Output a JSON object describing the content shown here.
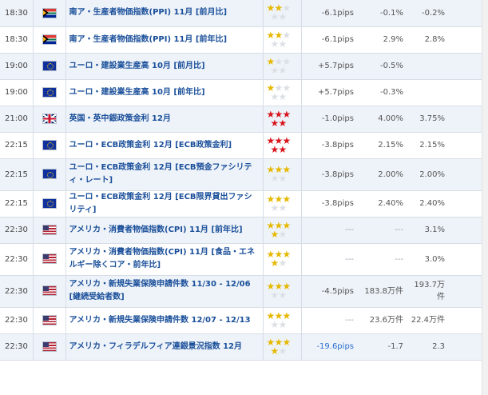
{
  "star_colors": {
    "gold": "#e6b800",
    "red": "#d9141b",
    "empty": "#dcdfe4"
  },
  "rows": [
    {
      "time": "18:30",
      "flag": "south-africa-flag",
      "event": "南ア・生産者物価指数(PPI) 11月 [前月比]",
      "stars": [
        2,
        0
      ],
      "pips": "-6.1pips",
      "prev": "-0.1%",
      "forecast": "-0.2%",
      "result": ""
    },
    {
      "time": "18:30",
      "flag": "south-africa-flag",
      "event": "南ア・生産者物価指数(PPI) 11月 [前年比]",
      "stars": [
        2,
        0
      ],
      "pips": "-6.1pips",
      "prev": "2.9%",
      "forecast": "2.8%",
      "result": ""
    },
    {
      "time": "19:00",
      "flag": "eu-flag",
      "event": "ユーロ・建設業生産高 10月 [前月比]",
      "stars": [
        1,
        0
      ],
      "pips": "+5.7pips",
      "prev": "-0.5%",
      "forecast": "",
      "result": ""
    },
    {
      "time": "19:00",
      "flag": "eu-flag",
      "event": "ユーロ・建設業生産高 10月 [前年比]",
      "stars": [
        1,
        0
      ],
      "pips": "+5.7pips",
      "prev": "-0.3%",
      "forecast": "",
      "result": ""
    },
    {
      "time": "21:00",
      "flag": "uk-flag",
      "event": "英国・英中銀政策金利 12月",
      "stars": [
        5,
        1
      ],
      "pips": "-1.0pips",
      "prev": "4.00%",
      "forecast": "3.75%",
      "result": ""
    },
    {
      "time": "22:15",
      "flag": "eu-flag",
      "event": "ユーロ・ECB政策金利 12月 [ECB政策金利]",
      "stars": [
        5,
        1
      ],
      "pips": "-3.8pips",
      "prev": "2.15%",
      "forecast": "2.15%",
      "result": ""
    },
    {
      "time": "22:15",
      "flag": "eu-flag",
      "event": "ユーロ・ECB政策金利 12月 [ECB預金ファシリティ・レート]",
      "stars": [
        3,
        0
      ],
      "pips": "-3.8pips",
      "prev": "2.00%",
      "forecast": "2.00%",
      "result": ""
    },
    {
      "time": "22:15",
      "flag": "eu-flag",
      "event": "ユーロ・ECB政策金利 12月 [ECB限界貸出ファシリティ]",
      "stars": [
        3,
        0
      ],
      "pips": "-3.8pips",
      "prev": "2.40%",
      "forecast": "2.40%",
      "result": ""
    },
    {
      "time": "22:30",
      "flag": "us-flag",
      "event": "アメリカ・消費者物価指数(CPI) 11月 [前年比]",
      "stars": [
        4,
        0
      ],
      "pips": "---",
      "prev": "---",
      "forecast": "3.1%",
      "result": ""
    },
    {
      "time": "22:30",
      "flag": "us-flag",
      "event": "アメリカ・消費者物価指数(CPI) 11月 [食品・エネルギー除くコア・前年比]",
      "stars": [
        4,
        0
      ],
      "pips": "---",
      "prev": "---",
      "forecast": "3.0%",
      "result": ""
    },
    {
      "time": "22:30",
      "flag": "us-flag",
      "event": "アメリカ・新規失業保険申請件数 11/30 - 12/06 [継続受給者数]",
      "stars": [
        3,
        0
      ],
      "pips": "-4.5pips",
      "prev": "183.8万件",
      "forecast": "193.7万件",
      "result": ""
    },
    {
      "time": "22:30",
      "flag": "us-flag",
      "event": "アメリカ・新規失業保険申請件数 12/07 - 12/13",
      "stars": [
        3,
        0
      ],
      "pips": "---",
      "prev": "23.6万件",
      "forecast": "22.4万件",
      "result": ""
    },
    {
      "time": "22:30",
      "flag": "us-flag",
      "event": "アメリカ・フィラデルフィア連銀景況指数 12月",
      "stars": [
        4,
        0
      ],
      "pips": "-19.6pips",
      "prev": "-1.7",
      "forecast": "2.3",
      "result": ""
    }
  ]
}
